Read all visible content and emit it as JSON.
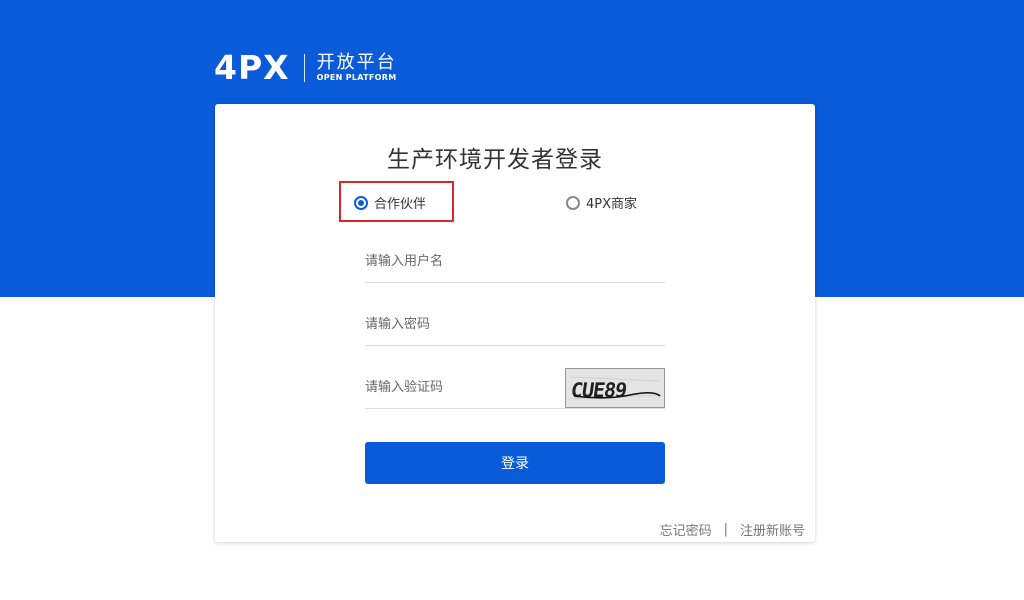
{
  "brand": {
    "logo_text": "4PX",
    "title_cn": "开放平台",
    "title_en": "OPEN PLATFORM"
  },
  "login": {
    "title": "生产环境开发者登录",
    "roles": [
      {
        "label": "合作伙伴",
        "checked": true
      },
      {
        "label": "4PX商家",
        "checked": false
      }
    ],
    "username_placeholder": "请输入用户名",
    "password_placeholder": "请输入密码",
    "captcha_placeholder": "请输入验证码",
    "captcha_text": "CUE89",
    "submit_label": "登录"
  },
  "links": {
    "forgot_password": "忘记密码",
    "separator": "|",
    "register": "注册新账号"
  },
  "colors": {
    "brand_blue": "#0a5bd9",
    "highlight_red": "#d9252b"
  }
}
